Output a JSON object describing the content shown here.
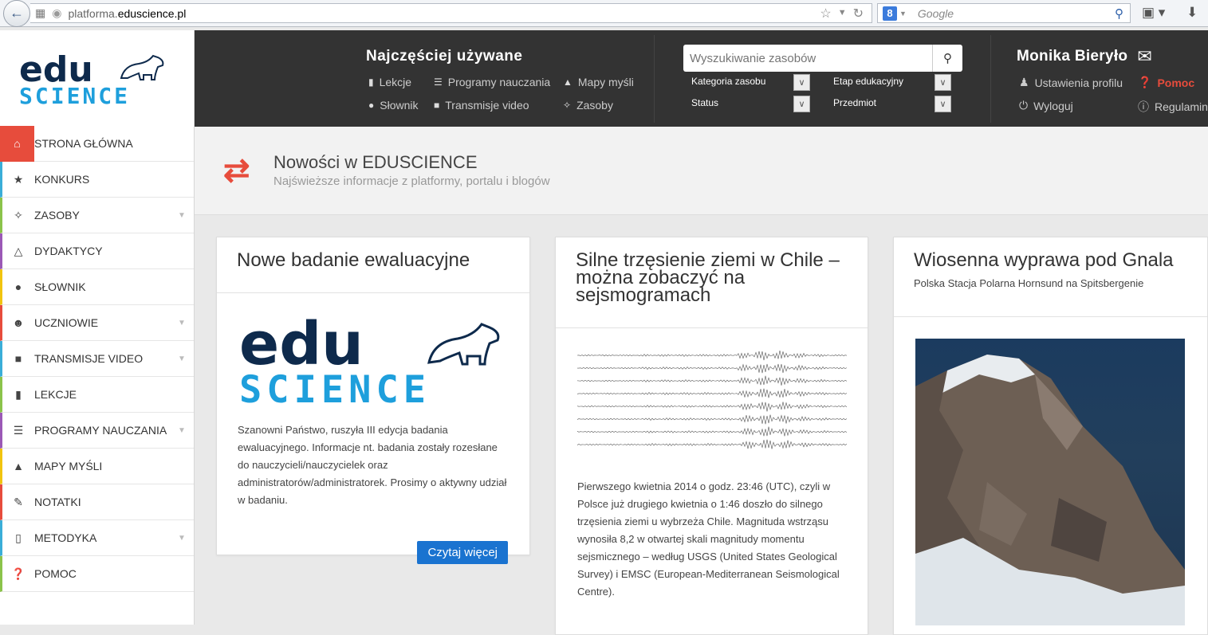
{
  "browser": {
    "url_prefix": "platforma.",
    "url_domain": "eduscience.pl",
    "search_placeholder": "Google",
    "search_engine_badge": "8"
  },
  "logo": {
    "top": "edu",
    "bottom": "SCIENCE"
  },
  "sidebar": {
    "items": [
      {
        "label": "STRONA GŁÓWNA",
        "icon": "home-icon",
        "color": "#e74c3c",
        "expandable": false
      },
      {
        "label": "KONKURS",
        "icon": "star-icon",
        "color": "#3aaed8",
        "expandable": false
      },
      {
        "label": "ZASOBY",
        "icon": "wand-icon",
        "color": "#8bc34a",
        "expandable": true
      },
      {
        "label": "DYDAKTYCY",
        "icon": "flask-icon",
        "color": "#9b59b6",
        "expandable": false
      },
      {
        "label": "SŁOWNIK",
        "icon": "microphone-icon",
        "color": "#f1c40f",
        "expandable": false
      },
      {
        "label": "UCZNIOWIE",
        "icon": "users-icon",
        "color": "#e74c3c",
        "expandable": true
      },
      {
        "label": "TRANSMISJE VIDEO",
        "icon": "video-camera-icon",
        "color": "#3aaed8",
        "expandable": true
      },
      {
        "label": "LEKCJE",
        "icon": "book-icon",
        "color": "#8bc34a",
        "expandable": false
      },
      {
        "label": "PROGRAMY NAUCZANIA",
        "icon": "list-icon",
        "color": "#9b59b6",
        "expandable": true
      },
      {
        "label": "MAPY MYŚLI",
        "icon": "sitemap-icon",
        "color": "#f1c40f",
        "expandable": false
      },
      {
        "label": "NOTATKI",
        "icon": "pencil-icon",
        "color": "#e74c3c",
        "expandable": false
      },
      {
        "label": "METODYKA",
        "icon": "notebook-icon",
        "color": "#3aaed8",
        "expandable": true
      },
      {
        "label": "POMOC",
        "icon": "question-icon",
        "color": "#8bc34a",
        "expandable": false
      }
    ]
  },
  "topbar": {
    "most_used_title": "Najczęściej używane",
    "links": {
      "lekcje": "Lekcje",
      "programy": "Programy nauczania",
      "mapy": "Mapy myśli",
      "slownik": "Słownik",
      "transmisje": "Transmisje video",
      "zasoby": "Zasoby"
    },
    "search_placeholder": "Wyszukiwanie zasobów",
    "filters": {
      "kategoria": "Kategoria zasobu",
      "etap": "Etap edukacyjny",
      "status": "Status",
      "przedmiot": "Przedmiot"
    },
    "user_name": "Monika Bieryło",
    "user_links": {
      "profile": "Ustawienia profilu",
      "help": "Pomoc",
      "logout": "Wyloguj",
      "rules": "Regulamin"
    }
  },
  "header": {
    "title": "Nowości w EDUSCIENCE",
    "subtitle": "Najświeższe informacje z platformy, portalu i blogów"
  },
  "cards": [
    {
      "title": "Nowe badanie ewaluacyjne",
      "text": "Szanowni Państwo, ruszyła III edycja badania ewaluacyjnego. Informacje nt. badania zostały rozesłane do nauczycieli/nauczycielek oraz administratorów/administratorek. Prosimy o aktywny udział w badaniu.",
      "button": "Czytaj więcej"
    },
    {
      "title": "Silne trzęsienie ziemi w Chile – można zobaczyć na sejsmogramach",
      "text": "Pierwszego kwietnia 2014 o godz. 23:46 (UTC), czyli w Polsce już drugiego kwietnia o 1:46 doszło do silnego trzęsienia ziemi u wybrzeża Chile. Magnituda wstrząsu wynosiła 8,2 w otwartej skali magnitudy momentu sejsmicznego – według USGS (United States Geological Survey) i EMSC (European-Mediterranean Seismological Centre)."
    },
    {
      "title": "Wiosenna wyprawa pod Gnala",
      "subtitle": "Polska Stacja Polarna Hornsund na Spitsbergenie"
    }
  ]
}
